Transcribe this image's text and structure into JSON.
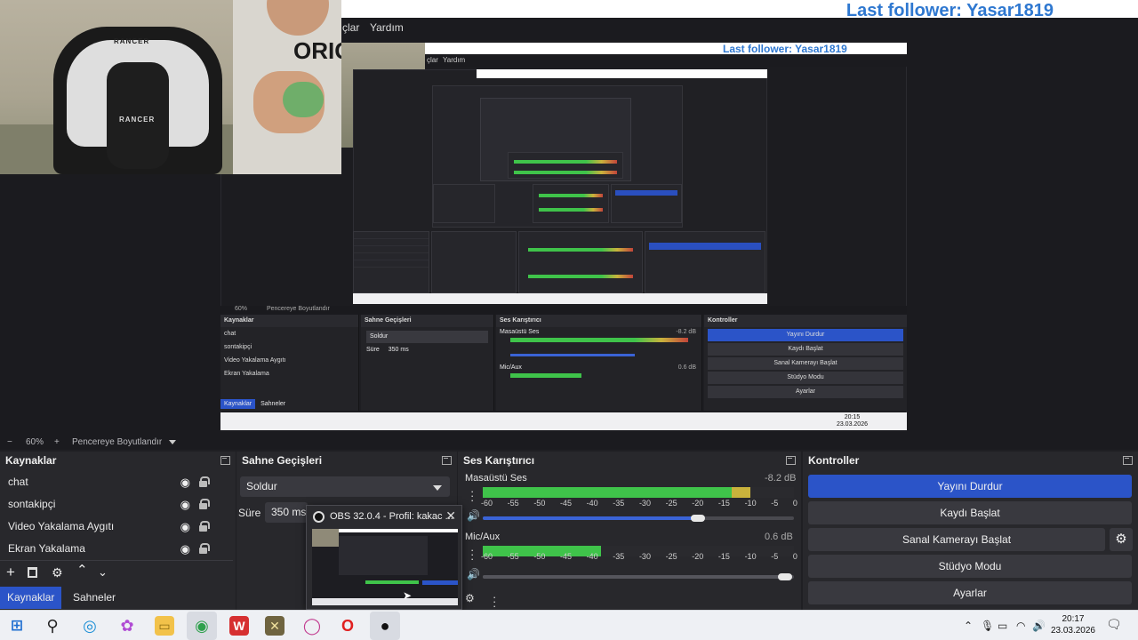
{
  "overlay": {
    "follower_text": "Last follower: Yasar1819"
  },
  "menu": {
    "items": [
      "çlar",
      "Yardım"
    ]
  },
  "webcam": {
    "chair_brand": "RANCER",
    "shirt_text": "ORIG"
  },
  "zoom": {
    "minus": "−",
    "level": "60%",
    "plus": "+",
    "fit_label": "Pencereye Boyutlandır"
  },
  "sources": {
    "title": "Kaynaklar",
    "items": [
      "chat",
      "sontakipçi",
      "Video Yakalama Aygıtı",
      "Ekran Yakalama"
    ]
  },
  "tabs": {
    "sources": "Kaynaklar",
    "scenes": "Sahneler"
  },
  "transitions": {
    "title": "Sahne Geçişleri",
    "selected": "Soldur",
    "duration_label": "Süre",
    "duration_value": "350 ms"
  },
  "mixer": {
    "title": "Ses Karıştırıcı",
    "scale": [
      "-60",
      "-55",
      "-50",
      "-45",
      "-40",
      "-35",
      "-30",
      "-25",
      "-20",
      "-15",
      "-10",
      "-5",
      "0"
    ],
    "channels": [
      {
        "name": "Masaüstü Ses",
        "db": "-8.2 dB",
        "level": 0.86,
        "volume": 0.69
      },
      {
        "name": "Mic/Aux",
        "db": "0.6 dB",
        "level": 0.38,
        "volume": 0.97
      }
    ]
  },
  "controls": {
    "title": "Kontroller",
    "stop_stream": "Yayını Durdur",
    "start_recording": "Kaydı Başlat",
    "start_virtual_cam": "Sanal Kamerayı Başlat",
    "studio_mode": "Stüdyo Modu",
    "settings": "Ayarlar"
  },
  "popup": {
    "title": "OBS 32.0.4 - Profil: kakac ..."
  },
  "taskbar": {
    "time": "20:17",
    "date": "23.03.2026"
  },
  "nested": {
    "sources": [
      "chat",
      "sontakipçi",
      "Video Yakalama Aygıtı",
      "Ekran Yakalama"
    ],
    "transition": "Soldur",
    "duration_label": "Süre",
    "duration": "350 ms",
    "mixer_ch1": "Masaüstü Ses",
    "mixer_ch2": "Mic/Aux",
    "db1": "-8.2 dB",
    "db2": "0.6 dB",
    "ctrl": [
      "Yayını Durdur",
      "Kaydı Başlat",
      "Sanal Kamerayı Başlat",
      "Stüdyo Modu",
      "Ayarlar"
    ],
    "zoom": "60%",
    "fit": "Pencereye Boyutlandır",
    "tabs": [
      "Kaynaklar",
      "Sahneler"
    ],
    "time": "20:15",
    "date": "23.03.2026",
    "menu": [
      "çlar",
      "Yardım"
    ],
    "headers": [
      "Kaynaklar",
      "Sahne Geçişleri",
      "Ses Karıştırıcı",
      "Kontroller"
    ]
  },
  "colors": {
    "accent": "#2b54c8",
    "follower": "#2f78d0",
    "meter_green": "#3fc34a"
  }
}
